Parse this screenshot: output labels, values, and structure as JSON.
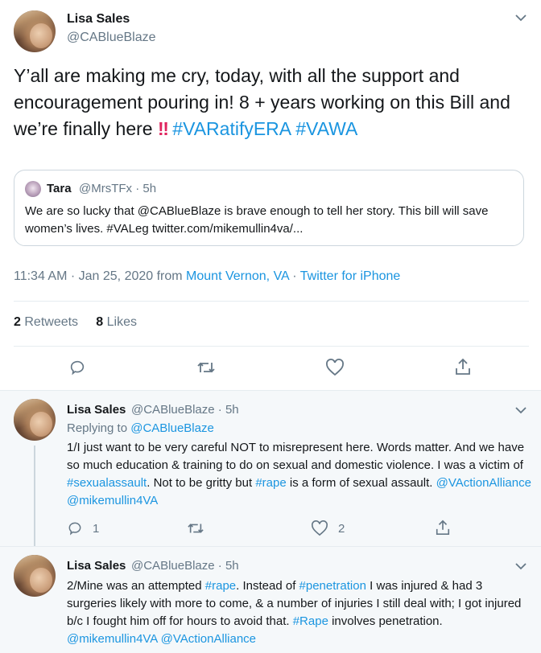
{
  "main_tweet": {
    "name": "Lisa Sales",
    "handle": "@CABlueBlaze",
    "text_part1": "Y’all are making me cry, today, with all the support and encouragement pouring in!  8 + years working on this Bill and we’re finally here",
    "emoji": "‼",
    "hashtag1": "#VARatifyERA",
    "hashtag2": "#VAWA",
    "quote": {
      "name": "Tara",
      "handle": "@MrsTFx · 5h",
      "text": "We are so lucky that @CABlueBlaze is brave enough to tell her story. This bill will save women’s lives. #VALeg twitter.com/mikemullin4va/..."
    },
    "meta_time": "11:34 AM · Jan 25, 2020 from ",
    "meta_location": "Mount Vernon, VA",
    "meta_sep": " · ",
    "meta_client": "Twitter for iPhone",
    "retweets_count": "2",
    "retweets_label": "Retweets",
    "likes_count": "8",
    "likes_label": "Likes"
  },
  "replies": [
    {
      "name": "Lisa Sales",
      "handle": "@CABlueBlaze · 5h",
      "replying_prefix": "Replying to ",
      "replying_to": "@CABlueBlaze",
      "text_a": "1/I just want to be very careful NOT to misrepresent here. Words matter. And we have so much education & training to do on sexual and domestic violence.  I was a victim of ",
      "tag_a": "#sexualassault",
      "text_b": ".  Not to be gritty but ",
      "tag_b": "#rape",
      "text_c": " is a form of sexual assault.  ",
      "mention_a": "@VActionAlliance",
      "mention_b": "@mikemullin4VA",
      "reply_count": "1",
      "like_count": "2"
    },
    {
      "name": "Lisa Sales",
      "handle": "@CABlueBlaze · 5h",
      "text_a": "2/Mine was an attempted ",
      "tag_a": "#rape",
      "text_b": ". Instead of ",
      "tag_b": "#penetration",
      "text_c": " I was injured & had 3 surgeries likely with more to come, & a number of injuries I still deal with; I got injured b/c I fought him off for hours to avoid that.  ",
      "tag_c": "#Rape",
      "text_d": " involves penetration. ",
      "mention_a": "@mikemullin4VA",
      "mention_b": "@VActionAlliance"
    }
  ]
}
